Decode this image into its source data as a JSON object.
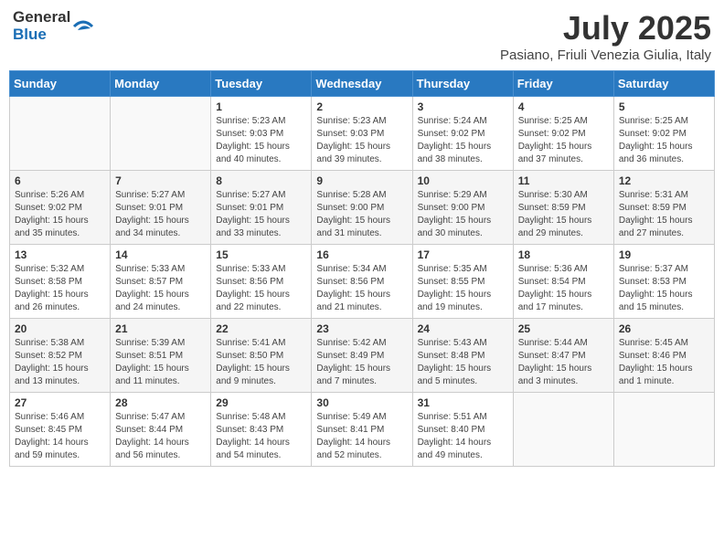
{
  "logo": {
    "general": "General",
    "blue": "Blue"
  },
  "title": "July 2025",
  "location": "Pasiano, Friuli Venezia Giulia, Italy",
  "weekdays": [
    "Sunday",
    "Monday",
    "Tuesday",
    "Wednesday",
    "Thursday",
    "Friday",
    "Saturday"
  ],
  "weeks": [
    [
      {
        "day": "",
        "info": ""
      },
      {
        "day": "",
        "info": ""
      },
      {
        "day": "1",
        "info": "Sunrise: 5:23 AM\nSunset: 9:03 PM\nDaylight: 15 hours and 40 minutes."
      },
      {
        "day": "2",
        "info": "Sunrise: 5:23 AM\nSunset: 9:03 PM\nDaylight: 15 hours and 39 minutes."
      },
      {
        "day": "3",
        "info": "Sunrise: 5:24 AM\nSunset: 9:02 PM\nDaylight: 15 hours and 38 minutes."
      },
      {
        "day": "4",
        "info": "Sunrise: 5:25 AM\nSunset: 9:02 PM\nDaylight: 15 hours and 37 minutes."
      },
      {
        "day": "5",
        "info": "Sunrise: 5:25 AM\nSunset: 9:02 PM\nDaylight: 15 hours and 36 minutes."
      }
    ],
    [
      {
        "day": "6",
        "info": "Sunrise: 5:26 AM\nSunset: 9:02 PM\nDaylight: 15 hours and 35 minutes."
      },
      {
        "day": "7",
        "info": "Sunrise: 5:27 AM\nSunset: 9:01 PM\nDaylight: 15 hours and 34 minutes."
      },
      {
        "day": "8",
        "info": "Sunrise: 5:27 AM\nSunset: 9:01 PM\nDaylight: 15 hours and 33 minutes."
      },
      {
        "day": "9",
        "info": "Sunrise: 5:28 AM\nSunset: 9:00 PM\nDaylight: 15 hours and 31 minutes."
      },
      {
        "day": "10",
        "info": "Sunrise: 5:29 AM\nSunset: 9:00 PM\nDaylight: 15 hours and 30 minutes."
      },
      {
        "day": "11",
        "info": "Sunrise: 5:30 AM\nSunset: 8:59 PM\nDaylight: 15 hours and 29 minutes."
      },
      {
        "day": "12",
        "info": "Sunrise: 5:31 AM\nSunset: 8:59 PM\nDaylight: 15 hours and 27 minutes."
      }
    ],
    [
      {
        "day": "13",
        "info": "Sunrise: 5:32 AM\nSunset: 8:58 PM\nDaylight: 15 hours and 26 minutes."
      },
      {
        "day": "14",
        "info": "Sunrise: 5:33 AM\nSunset: 8:57 PM\nDaylight: 15 hours and 24 minutes."
      },
      {
        "day": "15",
        "info": "Sunrise: 5:33 AM\nSunset: 8:56 PM\nDaylight: 15 hours and 22 minutes."
      },
      {
        "day": "16",
        "info": "Sunrise: 5:34 AM\nSunset: 8:56 PM\nDaylight: 15 hours and 21 minutes."
      },
      {
        "day": "17",
        "info": "Sunrise: 5:35 AM\nSunset: 8:55 PM\nDaylight: 15 hours and 19 minutes."
      },
      {
        "day": "18",
        "info": "Sunrise: 5:36 AM\nSunset: 8:54 PM\nDaylight: 15 hours and 17 minutes."
      },
      {
        "day": "19",
        "info": "Sunrise: 5:37 AM\nSunset: 8:53 PM\nDaylight: 15 hours and 15 minutes."
      }
    ],
    [
      {
        "day": "20",
        "info": "Sunrise: 5:38 AM\nSunset: 8:52 PM\nDaylight: 15 hours and 13 minutes."
      },
      {
        "day": "21",
        "info": "Sunrise: 5:39 AM\nSunset: 8:51 PM\nDaylight: 15 hours and 11 minutes."
      },
      {
        "day": "22",
        "info": "Sunrise: 5:41 AM\nSunset: 8:50 PM\nDaylight: 15 hours and 9 minutes."
      },
      {
        "day": "23",
        "info": "Sunrise: 5:42 AM\nSunset: 8:49 PM\nDaylight: 15 hours and 7 minutes."
      },
      {
        "day": "24",
        "info": "Sunrise: 5:43 AM\nSunset: 8:48 PM\nDaylight: 15 hours and 5 minutes."
      },
      {
        "day": "25",
        "info": "Sunrise: 5:44 AM\nSunset: 8:47 PM\nDaylight: 15 hours and 3 minutes."
      },
      {
        "day": "26",
        "info": "Sunrise: 5:45 AM\nSunset: 8:46 PM\nDaylight: 15 hours and 1 minute."
      }
    ],
    [
      {
        "day": "27",
        "info": "Sunrise: 5:46 AM\nSunset: 8:45 PM\nDaylight: 14 hours and 59 minutes."
      },
      {
        "day": "28",
        "info": "Sunrise: 5:47 AM\nSunset: 8:44 PM\nDaylight: 14 hours and 56 minutes."
      },
      {
        "day": "29",
        "info": "Sunrise: 5:48 AM\nSunset: 8:43 PM\nDaylight: 14 hours and 54 minutes."
      },
      {
        "day": "30",
        "info": "Sunrise: 5:49 AM\nSunset: 8:41 PM\nDaylight: 14 hours and 52 minutes."
      },
      {
        "day": "31",
        "info": "Sunrise: 5:51 AM\nSunset: 8:40 PM\nDaylight: 14 hours and 49 minutes."
      },
      {
        "day": "",
        "info": ""
      },
      {
        "day": "",
        "info": ""
      }
    ]
  ]
}
